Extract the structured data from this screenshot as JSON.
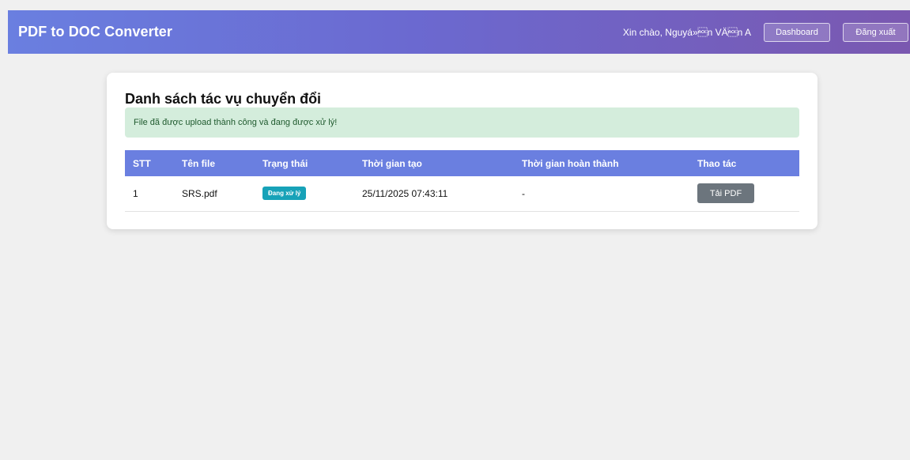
{
  "header": {
    "brand": "PDF to DOC Converter",
    "greeting": "Xin chào, Nguyá»\u0006n VÄ\u0006n A",
    "dashboard_label": "Dashboard",
    "logout_label": "Đăng xuất"
  },
  "main": {
    "title": "Danh sách tác vụ chuyển đổi",
    "alert": "File đã được upload thành công và đang được xử lý!",
    "table": {
      "columns": [
        "STT",
        "Tên file",
        "Trạng thái",
        "Thời gian tạo",
        "Thời gian hoàn thành",
        "Thao tác"
      ],
      "rows": [
        {
          "stt": "1",
          "filename": "SRS.pdf",
          "status": "Đang xử lý",
          "created": "25/11/2025 07:43:11",
          "completed": "-",
          "action": "Tải PDF"
        }
      ]
    }
  },
  "colors": {
    "header_start": "#6a7fe0",
    "header_end": "#7a58b0",
    "table_header": "#6a7fe0",
    "alert_bg": "#d4eddc",
    "status_badge": "#17a2b8",
    "action_button": "#6c757d"
  }
}
